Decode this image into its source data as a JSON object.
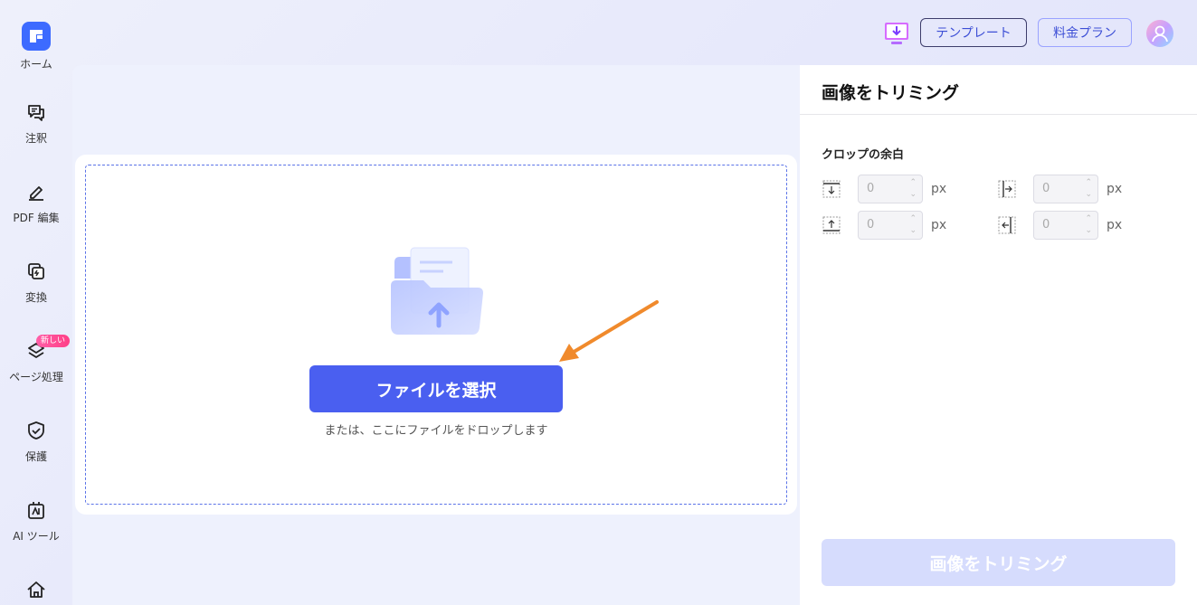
{
  "sidebar": {
    "items": [
      {
        "label": "ホーム",
        "icon": "logo-icon"
      },
      {
        "label": "注釈",
        "icon": "annotate-icon"
      },
      {
        "label": "PDF 編集",
        "icon": "edit-icon"
      },
      {
        "label": "変換",
        "icon": "convert-icon"
      },
      {
        "label": "ページ処理",
        "icon": "layers-icon",
        "badge": "新しい"
      },
      {
        "label": "保護",
        "icon": "shield-icon"
      },
      {
        "label": "AI ツール",
        "icon": "ai-tool-icon"
      },
      {
        "label": "",
        "icon": "home-icon"
      }
    ]
  },
  "header": {
    "download_icon": "download-desktop-icon",
    "template_label": "テンプレート",
    "pricing_label": "料金プラン",
    "avatar_icon": "user-avatar-icon"
  },
  "main": {
    "select_button": "ファイルを選択",
    "drop_hint": "または、ここにファイルをドロップします"
  },
  "right_panel": {
    "title": "画像をトリミング",
    "section_label": "クロップの余白",
    "margins": [
      {
        "side": "top",
        "value": "0",
        "unit": "px"
      },
      {
        "side": "left",
        "value": "0",
        "unit": "px"
      },
      {
        "side": "bottom",
        "value": "0",
        "unit": "px"
      },
      {
        "side": "right",
        "value": "0",
        "unit": "px"
      }
    ],
    "trim_button": "画像をトリミング"
  },
  "colors": {
    "accent": "#4a5ff0",
    "disabled_button": "#d6dcfd",
    "arrow": "#f08a2c",
    "badge": "#ff4f96"
  }
}
